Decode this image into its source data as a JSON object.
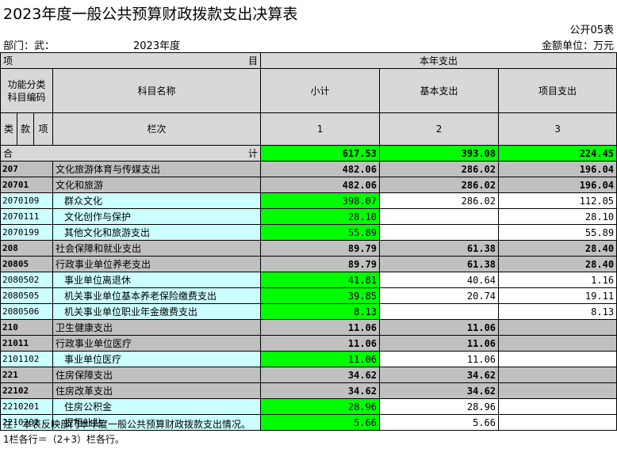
{
  "title": "2023年度一般公共预算财政拨款支出决算表",
  "form_no": "公开05表",
  "dept_label": "部门：武：",
  "year": "2023年度",
  "unit": "金额单位：万元",
  "header": {
    "item": "项",
    "mu": "目",
    "current_exp": "本年支出",
    "func_code": "功能分类科目编码",
    "subject_name": "科目名称",
    "subtotal": "小计",
    "basic": "基本支出",
    "project": "项目支出",
    "column_no": "栏次",
    "lei": "类",
    "kuan": "款",
    "xiang": "项",
    "col1": "1",
    "col2": "2",
    "col3": "3"
  },
  "total": {
    "label_he": "合",
    "label_ji": "计",
    "subtotal": "617.53",
    "basic": "393.08",
    "project": "224.45"
  },
  "rows": [
    {
      "code": "207",
      "name": "文化旅游体育与传媒支出",
      "subtotal": "482.06",
      "basic": "286.02",
      "project": "196.04",
      "level": 1
    },
    {
      "code": "20701",
      "name": "文化和旅游",
      "subtotal": "482.06",
      "basic": "286.02",
      "project": "196.04",
      "level": 2
    },
    {
      "code": "2070109",
      "name": "群众文化",
      "subtotal": "398.07",
      "basic": "286.02",
      "project": "112.05",
      "level": 3
    },
    {
      "code": "2070111",
      "name": "文化创作与保护",
      "subtotal": "28.10",
      "basic": "",
      "project": "28.10",
      "level": 3
    },
    {
      "code": "2070199",
      "name": "其他文化和旅游支出",
      "subtotal": "55.89",
      "basic": "",
      "project": "55.89",
      "level": 3
    },
    {
      "code": "208",
      "name": "社会保障和就业支出",
      "subtotal": "89.79",
      "basic": "61.38",
      "project": "28.40",
      "level": 1
    },
    {
      "code": "20805",
      "name": "行政事业单位养老支出",
      "subtotal": "89.79",
      "basic": "61.38",
      "project": "28.40",
      "level": 2
    },
    {
      "code": "2080502",
      "name": "事业单位离退休",
      "subtotal": "41.81",
      "basic": "40.64",
      "project": "1.16",
      "level": 3
    },
    {
      "code": "2080505",
      "name": "机关事业单位基本养老保险缴费支出",
      "subtotal": "39.85",
      "basic": "20.74",
      "project": "19.11",
      "level": 3
    },
    {
      "code": "2080506",
      "name": "机关事业单位职业年金缴费支出",
      "subtotal": "8.13",
      "basic": "",
      "project": "8.13",
      "level": 3
    },
    {
      "code": "210",
      "name": "卫生健康支出",
      "subtotal": "11.06",
      "basic": "11.06",
      "project": "",
      "level": 1
    },
    {
      "code": "21011",
      "name": "行政事业单位医疗",
      "subtotal": "11.06",
      "basic": "11.06",
      "project": "",
      "level": 2
    },
    {
      "code": "2101102",
      "name": "事业单位医疗",
      "subtotal": "11.06",
      "basic": "11.06",
      "project": "",
      "level": 3
    },
    {
      "code": "221",
      "name": "住房保障支出",
      "subtotal": "34.62",
      "basic": "34.62",
      "project": "",
      "level": 1
    },
    {
      "code": "22102",
      "name": "住房改革支出",
      "subtotal": "34.62",
      "basic": "34.62",
      "project": "",
      "level": 2
    },
    {
      "code": "2210201",
      "name": "住房公积金",
      "subtotal": "28.96",
      "basic": "28.96",
      "project": "",
      "level": 3
    },
    {
      "code": "2210202",
      "name": "提租补贴",
      "subtotal": "5.66",
      "basic": "5.66",
      "project": "",
      "level": 3
    }
  ],
  "notes": [
    "注：本表反映部门本年度一般公共预算财政拨款支出情况。",
    "1栏各行＝（2+3）栏各行。"
  ]
}
